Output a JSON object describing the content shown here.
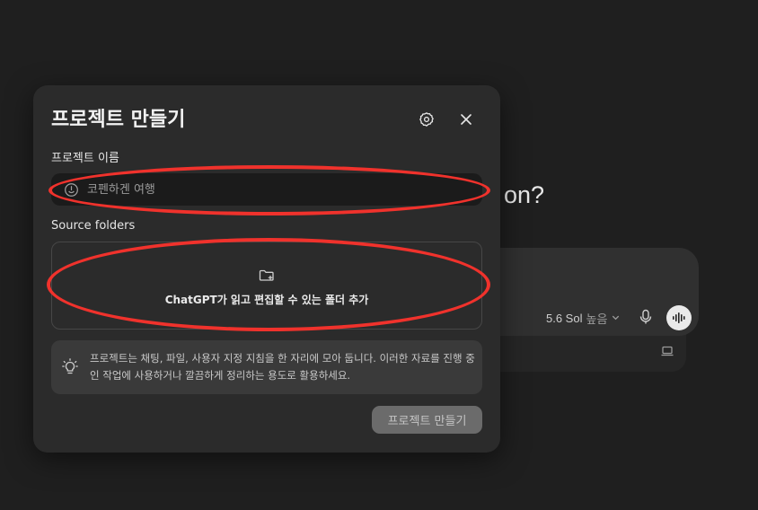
{
  "background": {
    "heading_fragment": "k on?",
    "composer": {
      "model_label": "5.6 Sol",
      "model_sub_label": "높음",
      "icons": [
        "chevron-down-icon",
        "microphone-icon",
        "voice-mode-icon",
        "laptop-icon"
      ]
    }
  },
  "modal": {
    "title": "프로젝트 만들기",
    "header_icons": [
      "gear-icon",
      "close-icon"
    ],
    "name_label": "프로젝트 이름",
    "name_placeholder": "코펜하겐 여행",
    "name_icon": "emoji-icon",
    "folders_label": "Source folders",
    "add_folder_label": "ChatGPT가 읽고 편집할 수 있는 폴더 추가",
    "add_folder_icon": "folder-plus-icon",
    "info_icon": "lightbulb-icon",
    "info_text": "프로젝트는 채팅, 파일, 사용자 지정 지침을 한 자리에 모아 둡니다. 이러한 자료를 진행 중인 작업에 사용하거나 깔끔하게 정리하는 용도로 활용하세요.",
    "create_button_label": "프로젝트 만들기"
  },
  "colors": {
    "background": "#1f1f1f",
    "modal": "#2b2b2b",
    "annotation": "#f0322c",
    "button_disabled": "#6b6b6b"
  }
}
